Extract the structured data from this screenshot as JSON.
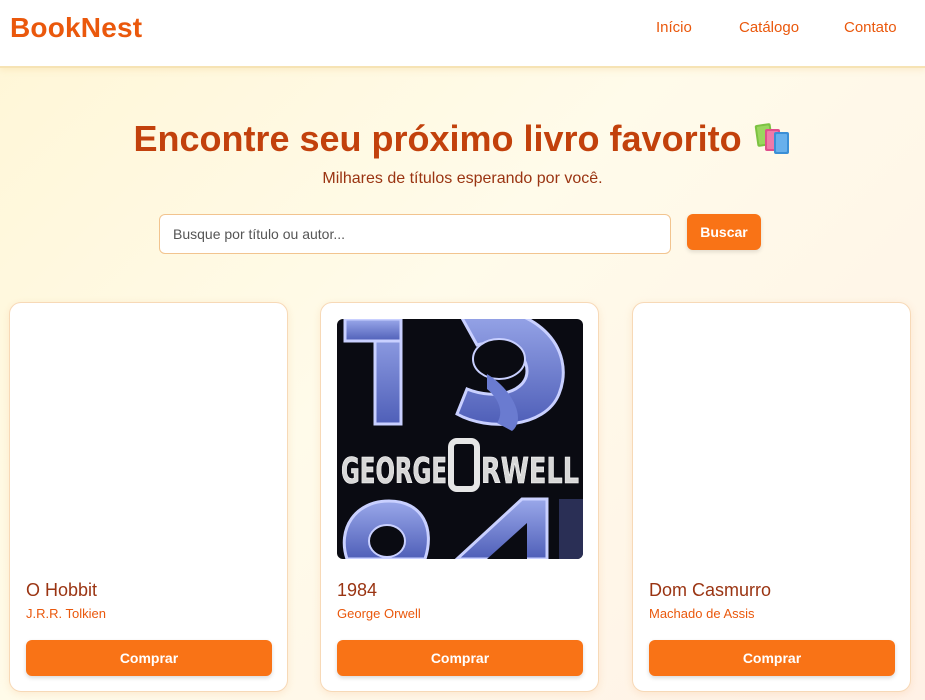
{
  "header": {
    "brand": "BookNest",
    "nav": [
      "Início",
      "Catálogo",
      "Contato"
    ]
  },
  "hero": {
    "title": "Encontre seu próximo livro favorito",
    "title_icon": "books-icon",
    "subtitle": "Milhares de títulos esperando por você."
  },
  "search": {
    "placeholder": "Busque por título ou autor...",
    "value": "",
    "button_label": "Buscar"
  },
  "books": [
    {
      "title": "O Hobbit",
      "author": "J.R.R. Tolkien",
      "button_label": "Comprar",
      "cover": "blank"
    },
    {
      "title": "1984",
      "author": "George Orwell",
      "button_label": "Comprar",
      "cover": "1984-cover-art"
    },
    {
      "title": "Dom Casmurro",
      "author": "Machado de Assis",
      "button_label": "Comprar",
      "cover": "blank"
    }
  ],
  "colors": {
    "accent": "#f97316",
    "brand": "#ea580c",
    "heading": "#c2410c"
  }
}
